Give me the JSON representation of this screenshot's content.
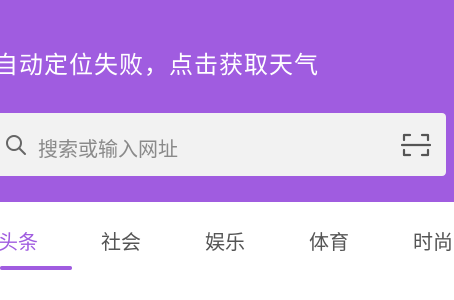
{
  "header": {
    "weather_text": "自动定位失败，点击获取天气",
    "background_color": "#a05ce0"
  },
  "search": {
    "placeholder": "搜索或输入网址",
    "left_icon": "search-icon",
    "right_icon": "scan-icon"
  },
  "tabs": {
    "items": [
      {
        "label": "头条",
        "active": true
      },
      {
        "label": "社会",
        "active": false
      },
      {
        "label": "娱乐",
        "active": false
      },
      {
        "label": "体育",
        "active": false
      },
      {
        "label": "时尚",
        "active": false
      }
    ],
    "accent_color": "#a05ce0",
    "text_color": "#555555"
  }
}
